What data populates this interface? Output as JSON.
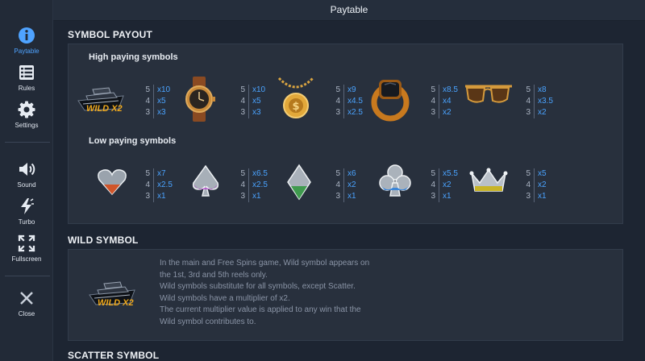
{
  "header": {
    "title": "Paytable"
  },
  "sidebar": {
    "paytable": "Paytable",
    "rules": "Rules",
    "settings": "Settings",
    "sound": "Sound",
    "turbo": "Turbo",
    "fullscreen": "Fullscreen",
    "close": "Close"
  },
  "symbol_payout": {
    "title": "SYMBOL PAYOUT",
    "high_title": "High paying symbols",
    "low_title": "Low paying symbols",
    "high": [
      {
        "name": "yacht",
        "badge": "WILD X2",
        "pays": [
          [
            "5",
            "x10"
          ],
          [
            "4",
            "x5"
          ],
          [
            "3",
            "x3"
          ]
        ]
      },
      {
        "name": "watch",
        "pays": [
          [
            "5",
            "x10"
          ],
          [
            "4",
            "x5"
          ],
          [
            "3",
            "x3"
          ]
        ]
      },
      {
        "name": "gold-chain",
        "pays": [
          [
            "5",
            "x9"
          ],
          [
            "4",
            "x4.5"
          ],
          [
            "3",
            "x2.5"
          ]
        ]
      },
      {
        "name": "ring",
        "pays": [
          [
            "5",
            "x8.5"
          ],
          [
            "4",
            "x4"
          ],
          [
            "3",
            "x2"
          ]
        ]
      },
      {
        "name": "sunglasses",
        "pays": [
          [
            "5",
            "x8"
          ],
          [
            "4",
            "x3.5"
          ],
          [
            "3",
            "x2"
          ]
        ]
      }
    ],
    "low": [
      {
        "name": "heart",
        "pays": [
          [
            "5",
            "x7"
          ],
          [
            "4",
            "x2.5"
          ],
          [
            "3",
            "x1"
          ]
        ]
      },
      {
        "name": "spade",
        "pays": [
          [
            "5",
            "x6.5"
          ],
          [
            "4",
            "x2.5"
          ],
          [
            "3",
            "x1"
          ]
        ]
      },
      {
        "name": "diamond",
        "pays": [
          [
            "5",
            "x6"
          ],
          [
            "4",
            "x2"
          ],
          [
            "3",
            "x1"
          ]
        ]
      },
      {
        "name": "club",
        "pays": [
          [
            "5",
            "x5.5"
          ],
          [
            "4",
            "x2"
          ],
          [
            "3",
            "x1"
          ]
        ]
      },
      {
        "name": "crown",
        "pays": [
          [
            "5",
            "x5"
          ],
          [
            "4",
            "x2"
          ],
          [
            "3",
            "x1"
          ]
        ]
      }
    ]
  },
  "wild_symbol": {
    "title": "WILD SYMBOL",
    "badge": "WILD X2",
    "lines": [
      "In the main and Free Spins game, Wild symbol appears on",
      "the 1st, 3rd and 5th reels only.",
      "Wild symbols substitute for all symbols, except Scatter.",
      "Wild symbols have a multiplier of x2.",
      "The current multiplier value is applied to any win that the",
      "Wild symbol contributes to."
    ]
  },
  "scatter_symbol": {
    "title": "SCATTER SYMBOL"
  },
  "colors": {
    "accent": "#4aa3ff",
    "gold": "#e8a21a"
  }
}
